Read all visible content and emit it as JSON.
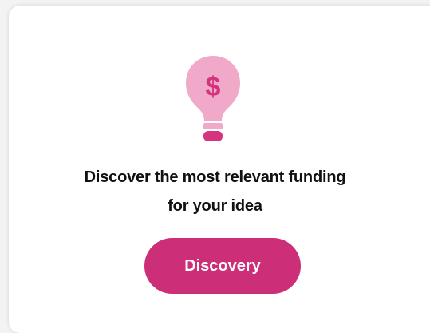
{
  "card": {
    "icon": "lightbulb-dollar-icon",
    "icon_symbol": "$",
    "headline_line1": "Discover the most relevant funding",
    "headline_line2": "for your idea",
    "button_label": "Discovery"
  },
  "colors": {
    "accent": "#cc2f77",
    "bulb_fill": "#f0a9c9",
    "bulb_base": "#d6337f",
    "text": "#111111",
    "card_bg": "#ffffff",
    "page_bg": "#f3f3f3"
  }
}
